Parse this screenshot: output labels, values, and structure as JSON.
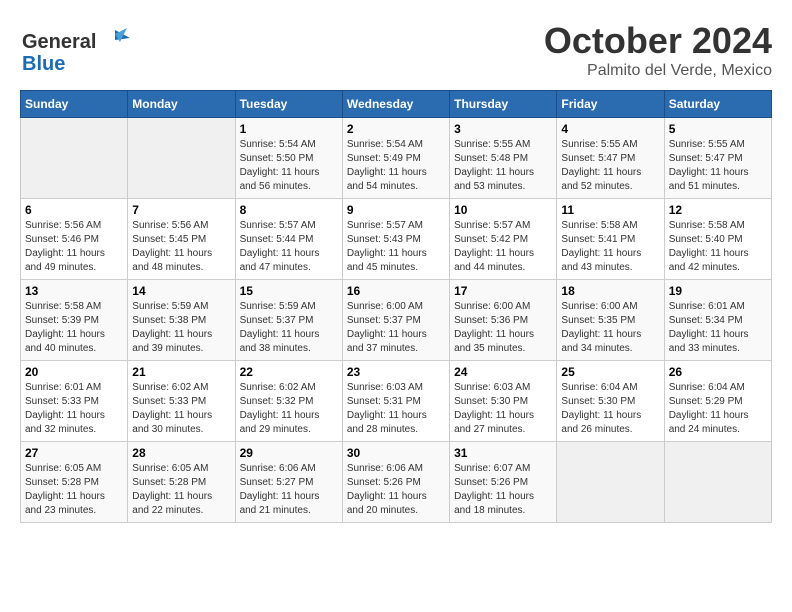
{
  "logo": {
    "line1": "General",
    "line2": "Blue"
  },
  "title": "October 2024",
  "location": "Palmito del Verde, Mexico",
  "weekdays": [
    "Sunday",
    "Monday",
    "Tuesday",
    "Wednesday",
    "Thursday",
    "Friday",
    "Saturday"
  ],
  "weeks": [
    [
      {
        "day": "",
        "sunrise": "",
        "sunset": "",
        "daylight": ""
      },
      {
        "day": "",
        "sunrise": "",
        "sunset": "",
        "daylight": ""
      },
      {
        "day": "1",
        "sunrise": "Sunrise: 5:54 AM",
        "sunset": "Sunset: 5:50 PM",
        "daylight": "Daylight: 11 hours and 56 minutes."
      },
      {
        "day": "2",
        "sunrise": "Sunrise: 5:54 AM",
        "sunset": "Sunset: 5:49 PM",
        "daylight": "Daylight: 11 hours and 54 minutes."
      },
      {
        "day": "3",
        "sunrise": "Sunrise: 5:55 AM",
        "sunset": "Sunset: 5:48 PM",
        "daylight": "Daylight: 11 hours and 53 minutes."
      },
      {
        "day": "4",
        "sunrise": "Sunrise: 5:55 AM",
        "sunset": "Sunset: 5:47 PM",
        "daylight": "Daylight: 11 hours and 52 minutes."
      },
      {
        "day": "5",
        "sunrise": "Sunrise: 5:55 AM",
        "sunset": "Sunset: 5:47 PM",
        "daylight": "Daylight: 11 hours and 51 minutes."
      }
    ],
    [
      {
        "day": "6",
        "sunrise": "Sunrise: 5:56 AM",
        "sunset": "Sunset: 5:46 PM",
        "daylight": "Daylight: 11 hours and 49 minutes."
      },
      {
        "day": "7",
        "sunrise": "Sunrise: 5:56 AM",
        "sunset": "Sunset: 5:45 PM",
        "daylight": "Daylight: 11 hours and 48 minutes."
      },
      {
        "day": "8",
        "sunrise": "Sunrise: 5:57 AM",
        "sunset": "Sunset: 5:44 PM",
        "daylight": "Daylight: 11 hours and 47 minutes."
      },
      {
        "day": "9",
        "sunrise": "Sunrise: 5:57 AM",
        "sunset": "Sunset: 5:43 PM",
        "daylight": "Daylight: 11 hours and 45 minutes."
      },
      {
        "day": "10",
        "sunrise": "Sunrise: 5:57 AM",
        "sunset": "Sunset: 5:42 PM",
        "daylight": "Daylight: 11 hours and 44 minutes."
      },
      {
        "day": "11",
        "sunrise": "Sunrise: 5:58 AM",
        "sunset": "Sunset: 5:41 PM",
        "daylight": "Daylight: 11 hours and 43 minutes."
      },
      {
        "day": "12",
        "sunrise": "Sunrise: 5:58 AM",
        "sunset": "Sunset: 5:40 PM",
        "daylight": "Daylight: 11 hours and 42 minutes."
      }
    ],
    [
      {
        "day": "13",
        "sunrise": "Sunrise: 5:58 AM",
        "sunset": "Sunset: 5:39 PM",
        "daylight": "Daylight: 11 hours and 40 minutes."
      },
      {
        "day": "14",
        "sunrise": "Sunrise: 5:59 AM",
        "sunset": "Sunset: 5:38 PM",
        "daylight": "Daylight: 11 hours and 39 minutes."
      },
      {
        "day": "15",
        "sunrise": "Sunrise: 5:59 AM",
        "sunset": "Sunset: 5:37 PM",
        "daylight": "Daylight: 11 hours and 38 minutes."
      },
      {
        "day": "16",
        "sunrise": "Sunrise: 6:00 AM",
        "sunset": "Sunset: 5:37 PM",
        "daylight": "Daylight: 11 hours and 37 minutes."
      },
      {
        "day": "17",
        "sunrise": "Sunrise: 6:00 AM",
        "sunset": "Sunset: 5:36 PM",
        "daylight": "Daylight: 11 hours and 35 minutes."
      },
      {
        "day": "18",
        "sunrise": "Sunrise: 6:00 AM",
        "sunset": "Sunset: 5:35 PM",
        "daylight": "Daylight: 11 hours and 34 minutes."
      },
      {
        "day": "19",
        "sunrise": "Sunrise: 6:01 AM",
        "sunset": "Sunset: 5:34 PM",
        "daylight": "Daylight: 11 hours and 33 minutes."
      }
    ],
    [
      {
        "day": "20",
        "sunrise": "Sunrise: 6:01 AM",
        "sunset": "Sunset: 5:33 PM",
        "daylight": "Daylight: 11 hours and 32 minutes."
      },
      {
        "day": "21",
        "sunrise": "Sunrise: 6:02 AM",
        "sunset": "Sunset: 5:33 PM",
        "daylight": "Daylight: 11 hours and 30 minutes."
      },
      {
        "day": "22",
        "sunrise": "Sunrise: 6:02 AM",
        "sunset": "Sunset: 5:32 PM",
        "daylight": "Daylight: 11 hours and 29 minutes."
      },
      {
        "day": "23",
        "sunrise": "Sunrise: 6:03 AM",
        "sunset": "Sunset: 5:31 PM",
        "daylight": "Daylight: 11 hours and 28 minutes."
      },
      {
        "day": "24",
        "sunrise": "Sunrise: 6:03 AM",
        "sunset": "Sunset: 5:30 PM",
        "daylight": "Daylight: 11 hours and 27 minutes."
      },
      {
        "day": "25",
        "sunrise": "Sunrise: 6:04 AM",
        "sunset": "Sunset: 5:30 PM",
        "daylight": "Daylight: 11 hours and 26 minutes."
      },
      {
        "day": "26",
        "sunrise": "Sunrise: 6:04 AM",
        "sunset": "Sunset: 5:29 PM",
        "daylight": "Daylight: 11 hours and 24 minutes."
      }
    ],
    [
      {
        "day": "27",
        "sunrise": "Sunrise: 6:05 AM",
        "sunset": "Sunset: 5:28 PM",
        "daylight": "Daylight: 11 hours and 23 minutes."
      },
      {
        "day": "28",
        "sunrise": "Sunrise: 6:05 AM",
        "sunset": "Sunset: 5:28 PM",
        "daylight": "Daylight: 11 hours and 22 minutes."
      },
      {
        "day": "29",
        "sunrise": "Sunrise: 6:06 AM",
        "sunset": "Sunset: 5:27 PM",
        "daylight": "Daylight: 11 hours and 21 minutes."
      },
      {
        "day": "30",
        "sunrise": "Sunrise: 6:06 AM",
        "sunset": "Sunset: 5:26 PM",
        "daylight": "Daylight: 11 hours and 20 minutes."
      },
      {
        "day": "31",
        "sunrise": "Sunrise: 6:07 AM",
        "sunset": "Sunset: 5:26 PM",
        "daylight": "Daylight: 11 hours and 18 minutes."
      },
      {
        "day": "",
        "sunrise": "",
        "sunset": "",
        "daylight": ""
      },
      {
        "day": "",
        "sunrise": "",
        "sunset": "",
        "daylight": ""
      }
    ]
  ]
}
